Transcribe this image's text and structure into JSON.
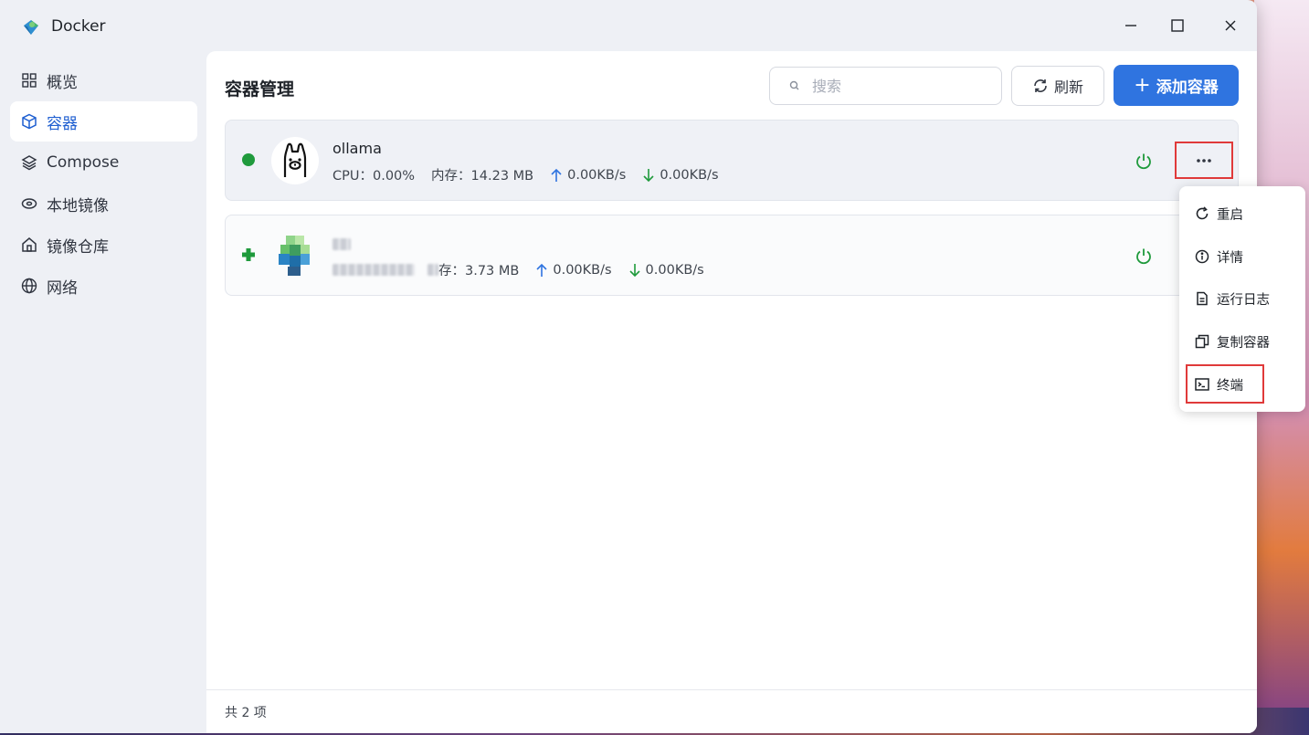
{
  "window": {
    "title": "Docker",
    "controls": {
      "minimize": "—",
      "maximize": "☐",
      "close": "✕"
    }
  },
  "sidebar": {
    "items": [
      {
        "label": "概览",
        "icon": "grid-icon",
        "active": false
      },
      {
        "label": "容器",
        "icon": "cube-icon",
        "active": true
      },
      {
        "label": "Compose",
        "icon": "layers-icon",
        "active": false
      },
      {
        "label": "本地镜像",
        "icon": "disk-icon",
        "active": false
      },
      {
        "label": "镜像仓库",
        "icon": "home-icon",
        "active": false
      },
      {
        "label": "网络",
        "icon": "globe-icon",
        "active": false
      }
    ]
  },
  "main": {
    "title": "容器管理",
    "search_placeholder": "搜索",
    "refresh_label": "刷新",
    "add_label": "添加容器",
    "footer": "共 2 项"
  },
  "containers": [
    {
      "name": "ollama",
      "status": "running",
      "cpu": "CPU：0.00%",
      "mem": "内存：14.23 MB",
      "up": "0.00KB/s",
      "down": "0.00KB/s"
    },
    {
      "name": "",
      "status": "running",
      "cpu": "",
      "mem": "存：3.73 MB",
      "up": "0.00KB/s",
      "down": "0.00KB/s"
    }
  ],
  "dropdown": {
    "items": [
      {
        "label": "重启",
        "icon": "restart-icon"
      },
      {
        "label": "详情",
        "icon": "info-icon"
      },
      {
        "label": "运行日志",
        "icon": "log-icon"
      },
      {
        "label": "复制容器",
        "icon": "copy-icon"
      },
      {
        "label": "终端",
        "icon": "terminal-icon"
      }
    ]
  },
  "colors": {
    "accent": "#2f74e0",
    "running": "#1f9a3c",
    "highlight": "#e03a3a"
  }
}
